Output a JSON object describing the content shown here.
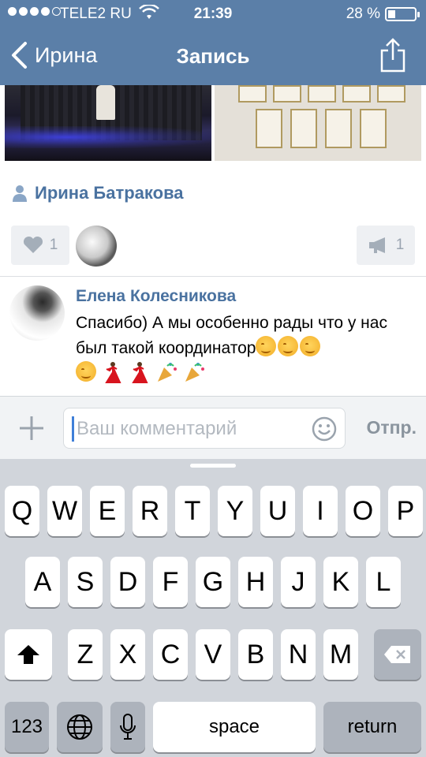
{
  "status_bar": {
    "carrier": "TELE2 RU",
    "time": "21:39",
    "battery": "28 %",
    "battery_level": 0.28
  },
  "nav": {
    "back_label": "Ирина",
    "title": "Запись"
  },
  "post": {
    "author": "Ирина Батракова",
    "likes": "1",
    "reposts": "1"
  },
  "comment": {
    "author": "Елена Колесникова",
    "text": "Спасибо) А мы особенно рады что у нас был такой координатор",
    "emojis": [
      "relaxed",
      "relaxed",
      "relaxed",
      "relaxed",
      "dancer",
      "dancer",
      "party",
      "party"
    ]
  },
  "composer": {
    "placeholder": "Ваш комментарий",
    "send_label": "Отпр."
  },
  "keyboard": {
    "row1": [
      "Q",
      "W",
      "E",
      "R",
      "T",
      "Y",
      "U",
      "I",
      "O",
      "P"
    ],
    "row2": [
      "A",
      "S",
      "D",
      "F",
      "G",
      "H",
      "J",
      "K",
      "L"
    ],
    "row3": [
      "Z",
      "X",
      "C",
      "V",
      "B",
      "N",
      "M"
    ],
    "numbers_label": "123",
    "space_label": "space",
    "return_label": "return"
  },
  "colors": {
    "header": "#5b7fa8",
    "link": "#4a72a0",
    "keyboard_bg": "#d1d5db"
  }
}
